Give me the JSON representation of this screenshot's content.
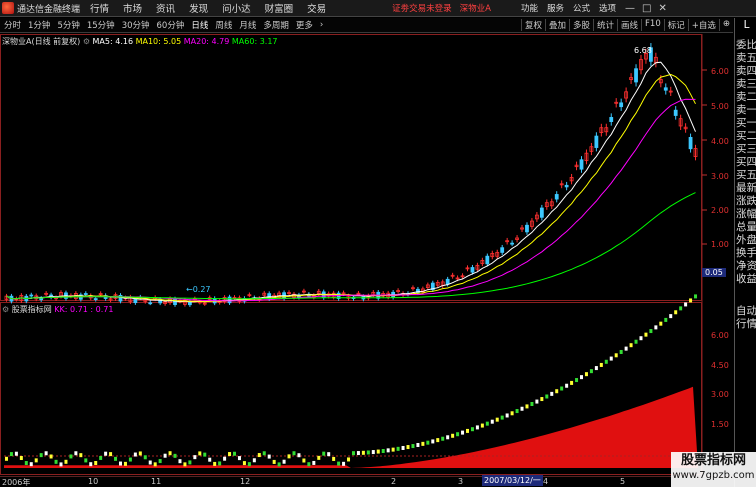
{
  "titlebar": {
    "app_name": "通达信金融终端",
    "menus": [
      "行情",
      "市场",
      "资讯",
      "发现",
      "问小达",
      "财富圈",
      "交易"
    ],
    "warning": "证劵交易未登录",
    "stock_name": "深物业A",
    "right_menus": [
      "功能",
      "服务",
      "公式",
      "选项"
    ],
    "win_buttons": [
      "—",
      "□",
      "✕"
    ]
  },
  "toolbar": {
    "periods": [
      "分时",
      "1分钟",
      "5分钟",
      "15分钟",
      "30分钟",
      "60分钟",
      "日线",
      "周线",
      "月线",
      "多周期",
      "更多"
    ],
    "active_period": "日线",
    "more_arrow": "›",
    "right_buttons": [
      "复权",
      "叠加",
      "多股",
      "统计",
      "画线",
      "F10",
      "标记",
      "+自选",
      "⊕"
    ]
  },
  "main_info": {
    "title": "深物业A(日线 前复权)",
    "ma5": "MA5: 4.16",
    "ma10": "MA10: 5.05",
    "ma20": "MA20: 4.79",
    "ma60": "MA60: 3.17"
  },
  "sub_info": {
    "title": "股票指标网",
    "kk": "KK: 0.71",
    "kk2": ": 0.71"
  },
  "price_axis": [
    "6.00",
    "5.00",
    "4.00",
    "3.00",
    "2.00",
    "1.00"
  ],
  "cursor_price": "0.05",
  "sub_axis": [
    "6.00",
    "4.50",
    "3.00",
    "1.50"
  ],
  "annotations": {
    "high": "6.68",
    "low": "0.27"
  },
  "right_column": {
    "items": [
      "L",
      "委比",
      "卖五",
      "卖四",
      "卖三",
      "卖二",
      "卖一",
      "买一",
      "买二",
      "买三",
      "买四",
      "买五",
      "最新",
      "涨跌",
      "涨幅",
      "总量",
      "外盘",
      "换手",
      "净资",
      "收益",
      "自动",
      "行情"
    ]
  },
  "date_axis": [
    "2006年",
    "10",
    "11",
    "12",
    "2",
    "3",
    "4",
    "5"
  ],
  "cursor_date": "2007/03/12/一",
  "watermark": {
    "line1": "股票指标网",
    "line2": "www.7gpzb.com"
  },
  "colors": {
    "up": "#ff3030",
    "down": "#3cc8ff",
    "ma5": "#ffffff",
    "ma10": "#ffff00",
    "ma20": "#ff00ff",
    "ma60": "#00ff00"
  }
}
